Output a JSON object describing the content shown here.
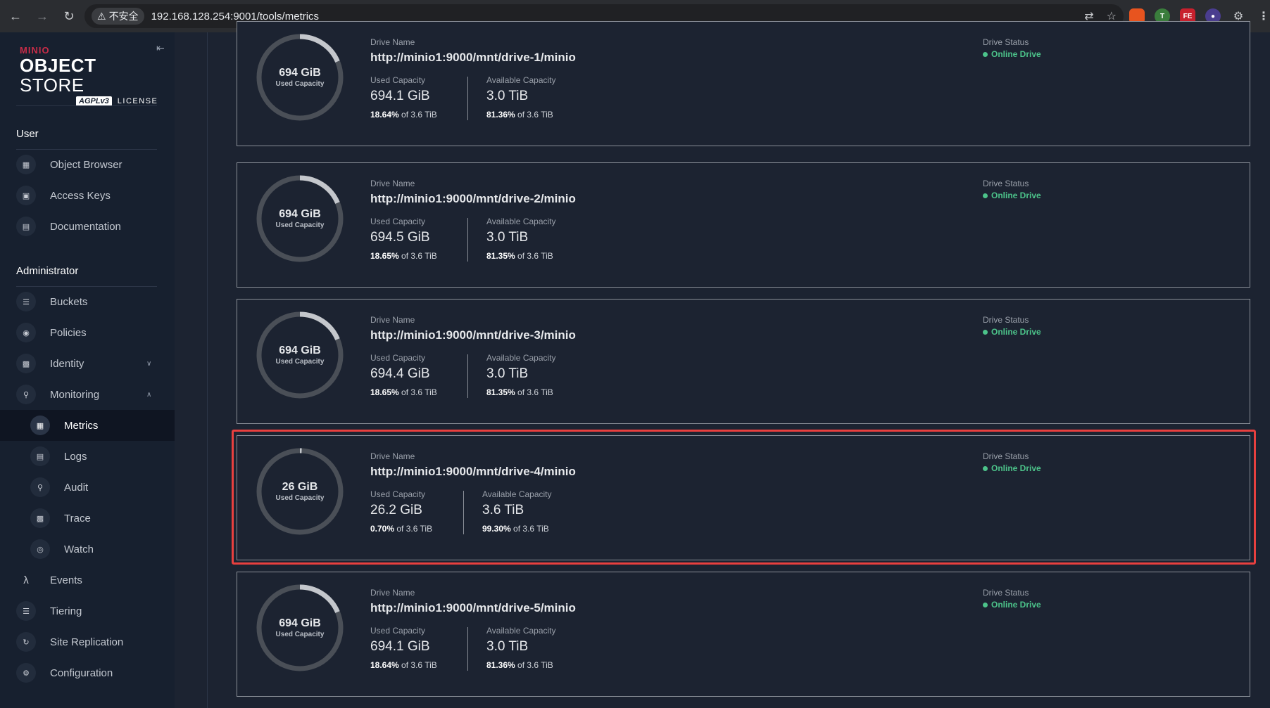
{
  "browser": {
    "insecure_label": "不安全",
    "url": "192.168.128.254:9001/tools/metrics"
  },
  "logo": {
    "brand": "MINIO",
    "title_bold": "OBJECT",
    "title_light": "STORE",
    "agpl": "AGPLv3",
    "license": "LICENSE"
  },
  "sidebar": {
    "user_section": "User",
    "admin_section": "Administrator",
    "user_items": [
      {
        "label": "Object Browser",
        "icon": "object-browser-icon"
      },
      {
        "label": "Access Keys",
        "icon": "access-keys-icon"
      },
      {
        "label": "Documentation",
        "icon": "documentation-icon"
      }
    ],
    "admin_items": [
      {
        "label": "Buckets",
        "icon": "buckets-icon"
      },
      {
        "label": "Policies",
        "icon": "policies-icon"
      },
      {
        "label": "Identity",
        "icon": "identity-icon"
      },
      {
        "label": "Monitoring",
        "icon": "monitoring-icon"
      },
      {
        "label": "Metrics",
        "icon": "metrics-icon"
      },
      {
        "label": "Logs",
        "icon": "logs-icon"
      },
      {
        "label": "Audit",
        "icon": "audit-icon"
      },
      {
        "label": "Trace",
        "icon": "trace-icon"
      },
      {
        "label": "Watch",
        "icon": "watch-icon"
      },
      {
        "label": "Events",
        "icon": "events-icon"
      },
      {
        "label": "Tiering",
        "icon": "tiering-icon"
      },
      {
        "label": "Site Replication",
        "icon": "site-replication-icon"
      },
      {
        "label": "Configuration",
        "icon": "configuration-icon"
      }
    ]
  },
  "labels": {
    "drive_name": "Drive Name",
    "used_capacity": "Used Capacity",
    "available_capacity": "Available Capacity",
    "drive_status": "Drive Status",
    "donut_caption": "Used Capacity",
    "of": "of"
  },
  "drives": [
    {
      "donut": "694 GiB",
      "name": "http://minio1:9000/mnt/drive-1/minio",
      "used": "694.1 GiB",
      "used_pct": "18.64%",
      "total": "3.6 TiB",
      "avail": "3.0 TiB",
      "avail_pct": "81.36%",
      "status": "Online Drive",
      "used_fraction": 0.1864
    },
    {
      "donut": "694 GiB",
      "name": "http://minio1:9000/mnt/drive-2/minio",
      "used": "694.5 GiB",
      "used_pct": "18.65%",
      "total": "3.6 TiB",
      "avail": "3.0 TiB",
      "avail_pct": "81.35%",
      "status": "Online Drive",
      "used_fraction": 0.1865
    },
    {
      "donut": "694 GiB",
      "name": "http://minio1:9000/mnt/drive-3/minio",
      "used": "694.4 GiB",
      "used_pct": "18.65%",
      "total": "3.6 TiB",
      "avail": "3.0 TiB",
      "avail_pct": "81.35%",
      "status": "Online Drive",
      "used_fraction": 0.1865
    },
    {
      "donut": "26 GiB",
      "name": "http://minio1:9000/mnt/drive-4/minio",
      "used": "26.2 GiB",
      "used_pct": "0.70%",
      "total": "3.6 TiB",
      "avail": "3.6 TiB",
      "avail_pct": "99.30%",
      "status": "Online Drive",
      "used_fraction": 0.007
    },
    {
      "donut": "694 GiB",
      "name": "http://minio1:9000/mnt/drive-5/minio",
      "used": "694.1 GiB",
      "used_pct": "18.64%",
      "total": "3.6 TiB",
      "avail": "3.0 TiB",
      "avail_pct": "81.36%",
      "status": "Online Drive",
      "used_fraction": 0.1864
    }
  ],
  "colors": {
    "status_online": "#4cc38a",
    "highlight": "#e8403f",
    "donut_track": "#4a4f57",
    "donut_used": "#c4c7cc"
  }
}
